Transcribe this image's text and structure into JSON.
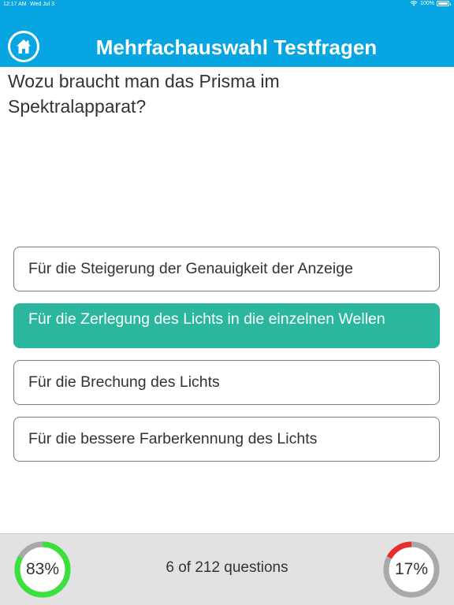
{
  "status_bar": {
    "time": "12:17 AM",
    "date": "Wed Jul 3",
    "battery": "100%"
  },
  "header": {
    "title": "Mehrfachauswahl Testfragen",
    "home_icon": "house-icon"
  },
  "question": {
    "text": "Wozu braucht man das Prisma im Spektralapparat?"
  },
  "answers": [
    {
      "label": "Für die Steigerung der Genauigkeit der Anzeige",
      "selected": false
    },
    {
      "label": "Für die Zerlegung des Lichts in die einzelnen Wellen",
      "selected": true
    },
    {
      "label": "Für die Brechung des Lichts",
      "selected": false
    },
    {
      "label": "Für die bessere Farberkennung des Lichts",
      "selected": false
    }
  ],
  "footer": {
    "correct_percent_label": "83%",
    "correct_fraction": 0.83,
    "correct_color": "#3ce03c",
    "wrong_percent_label": "17%",
    "wrong_fraction": 0.17,
    "wrong_color": "#ea2b2b",
    "track_color": "#a9a9a9",
    "progress_text": "6 of 212 questions"
  },
  "colors": {
    "header_bg": "#08a5e3",
    "selected_answer_bg": "#2bb79e",
    "footer_bg": "#e2e2e2"
  }
}
